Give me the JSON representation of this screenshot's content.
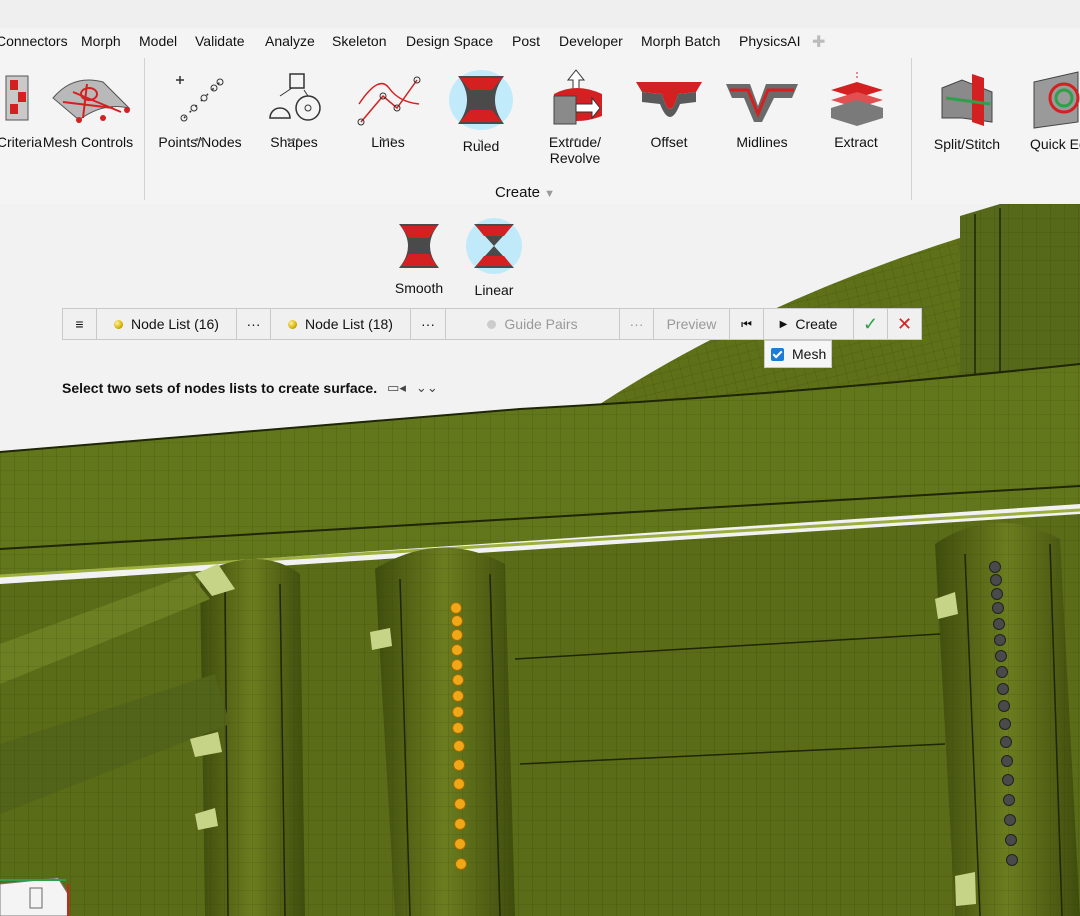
{
  "menu": [
    {
      "label": "Connectors"
    },
    {
      "label": "Morph"
    },
    {
      "label": "Model"
    },
    {
      "label": "Validate"
    },
    {
      "label": "Analyze"
    },
    {
      "label": "Skeleton"
    },
    {
      "label": "Design Space"
    },
    {
      "label": "Post"
    },
    {
      "label": "Developer"
    },
    {
      "label": "Morph Batch"
    },
    {
      "label": "PhysicsAI"
    }
  ],
  "ribbon": {
    "tools": [
      {
        "label": "Criteria"
      },
      {
        "label": "Mesh Controls"
      },
      {
        "label": "Points/Nodes"
      },
      {
        "label": "Shapes"
      },
      {
        "label": "Lines"
      },
      {
        "label": "Ruled"
      },
      {
        "label": "Extrude/\nRevolve"
      },
      {
        "label": "Offset"
      },
      {
        "label": "Midlines"
      },
      {
        "label": "Extract"
      },
      {
        "label": "Split/Stitch"
      },
      {
        "label": "Quick Ed"
      }
    ],
    "group_label": "Create"
  },
  "subtools": [
    {
      "label": "Smooth"
    },
    {
      "label": "Linear"
    }
  ],
  "toolbar": {
    "node_list_1": "Node List (16)",
    "node_list_2": "Node List (18)",
    "guide_pairs": "Guide Pairs",
    "preview": "Preview",
    "create": "Create",
    "mesh_label": "Mesh"
  },
  "status": "Select two sets of nodes lists to create surface.",
  "colors": {
    "model_green": "#5a6b17",
    "node_orange": "#f0a818",
    "node_grey": "#4a4a4a",
    "accent_red": "#d42020",
    "accent_blue": "#1c7cd6"
  }
}
